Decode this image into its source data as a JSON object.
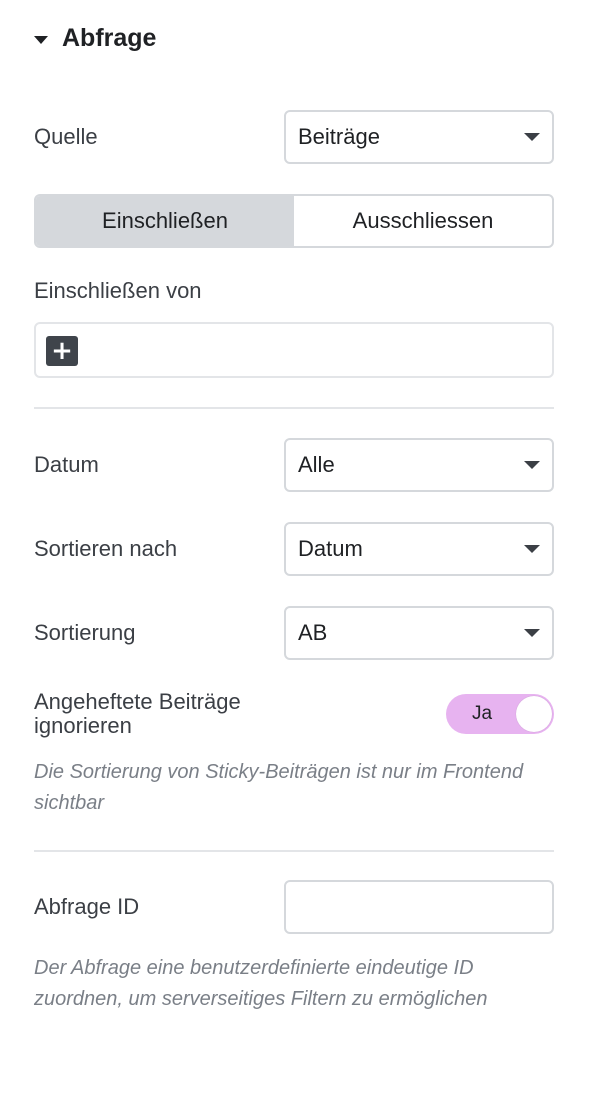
{
  "section": {
    "title": "Abfrage",
    "caret_icon": "caret-down-icon"
  },
  "source": {
    "label": "Quelle",
    "value": "Beiträge"
  },
  "segmented": {
    "include": "Einschließen",
    "exclude": "Ausschliessen",
    "active": "include"
  },
  "include_by": {
    "label": "Einschließen von",
    "add_icon": "plus-icon"
  },
  "date": {
    "label": "Datum",
    "value": "Alle"
  },
  "order_by": {
    "label": "Sortieren nach",
    "value": "Datum"
  },
  "order": {
    "label": "Sortierung",
    "value": "AB"
  },
  "sticky": {
    "label": "Angeheftete Beiträge ignorieren",
    "toggle_text": "Ja",
    "enabled": true,
    "hint": "Die Sortierung von Sticky-Beiträgen ist nur im Frontend sichtbar"
  },
  "query_id": {
    "label": "Abfrage ID",
    "value": "",
    "icon": "database-icon",
    "hint": "Der Abfrage eine benutzerdefinierte eindeutige ID zuordnen, um serverseitiges Filtern zu ermöglichen"
  },
  "colors": {
    "toggle_on": "#e7b3f0",
    "active_segment": "#d5d8dc",
    "dark_button": "#3f444b"
  }
}
